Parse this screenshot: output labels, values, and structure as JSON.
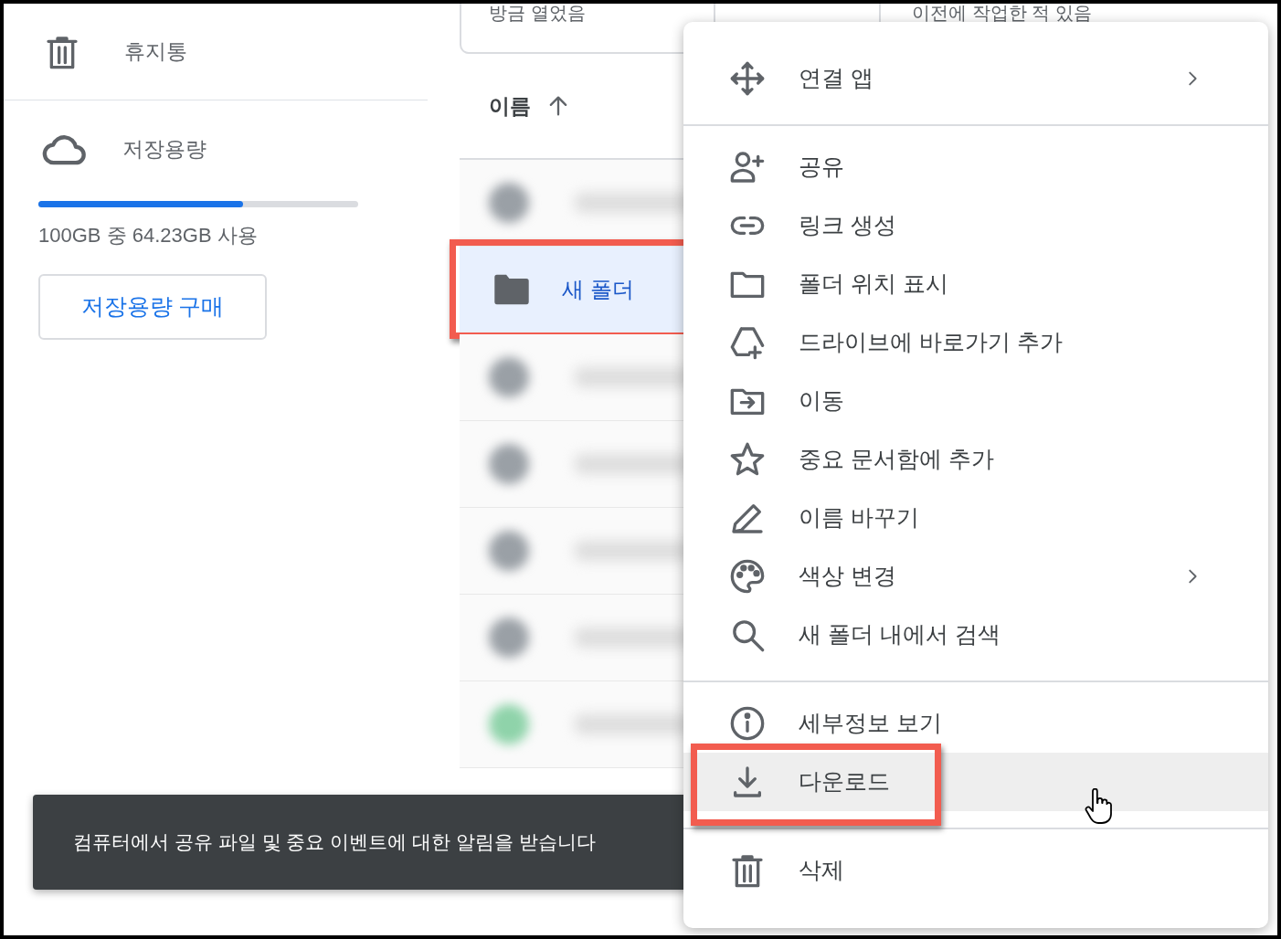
{
  "sidebar": {
    "trash": {
      "label": "휴지통"
    },
    "storage": {
      "label": "저장용량",
      "level": 0.64,
      "usage": "100GB 중 64.23GB 사용",
      "buy_button": "저장용량 구매"
    }
  },
  "quick_access": [
    "방금 열었음",
    "이전에 작업한 적 있음"
  ],
  "file_list": {
    "sort_column": "이름",
    "rows": [
      {
        "kind": "blurred",
        "color": "#9aa0a6"
      },
      {
        "kind": "folder",
        "name": "새 폴더",
        "selected": true,
        "annotated": true
      },
      {
        "kind": "blurred",
        "color": "#9aa0a6"
      },
      {
        "kind": "blurred",
        "color": "#9aa0a6"
      },
      {
        "kind": "blurred",
        "color": "#9aa0a6"
      },
      {
        "kind": "blurred",
        "color": "#9aa0a6"
      },
      {
        "kind": "blurred",
        "color": "#8fd3aa"
      }
    ]
  },
  "snackbar": "컴퓨터에서 공유 파일 및 중요 이벤트에 대한 알림을 받습니다",
  "context_menu": {
    "groups": [
      [
        {
          "kind": "move",
          "label": "연결 앱",
          "submenu": true,
          "hovered": false,
          "annotated": false
        }
      ],
      [
        {
          "kind": "share",
          "label": "공유",
          "submenu": false,
          "hovered": false,
          "annotated": false
        },
        {
          "kind": "link",
          "label": "링크 생성",
          "submenu": false,
          "hovered": false,
          "annotated": false
        },
        {
          "kind": "folder",
          "label": "폴더 위치 표시",
          "submenu": false,
          "hovered": false,
          "annotated": false
        },
        {
          "kind": "shortcut",
          "label": "드라이브에 바로가기 추가",
          "submenu": false,
          "hovered": false,
          "annotated": false
        },
        {
          "kind": "movefolder",
          "label": "이동",
          "submenu": false,
          "hovered": false,
          "annotated": false
        },
        {
          "kind": "star",
          "label": "중요 문서함에 추가",
          "submenu": false,
          "hovered": false,
          "annotated": false
        },
        {
          "kind": "rename",
          "label": "이름 바꾸기",
          "submenu": false,
          "hovered": false,
          "annotated": false
        },
        {
          "kind": "palette",
          "label": "색상 변경",
          "submenu": true,
          "hovered": false,
          "annotated": false
        },
        {
          "kind": "search",
          "label": "새 폴더 내에서 검색",
          "submenu": false,
          "hovered": false,
          "annotated": false
        }
      ],
      [
        {
          "kind": "info",
          "label": "세부정보 보기",
          "submenu": false,
          "hovered": false,
          "annotated": false
        },
        {
          "kind": "download",
          "label": "다운로드",
          "submenu": false,
          "hovered": true,
          "annotated": true
        }
      ],
      [
        {
          "kind": "trash",
          "label": "삭제",
          "submenu": false,
          "hovered": false,
          "annotated": false
        }
      ]
    ]
  }
}
